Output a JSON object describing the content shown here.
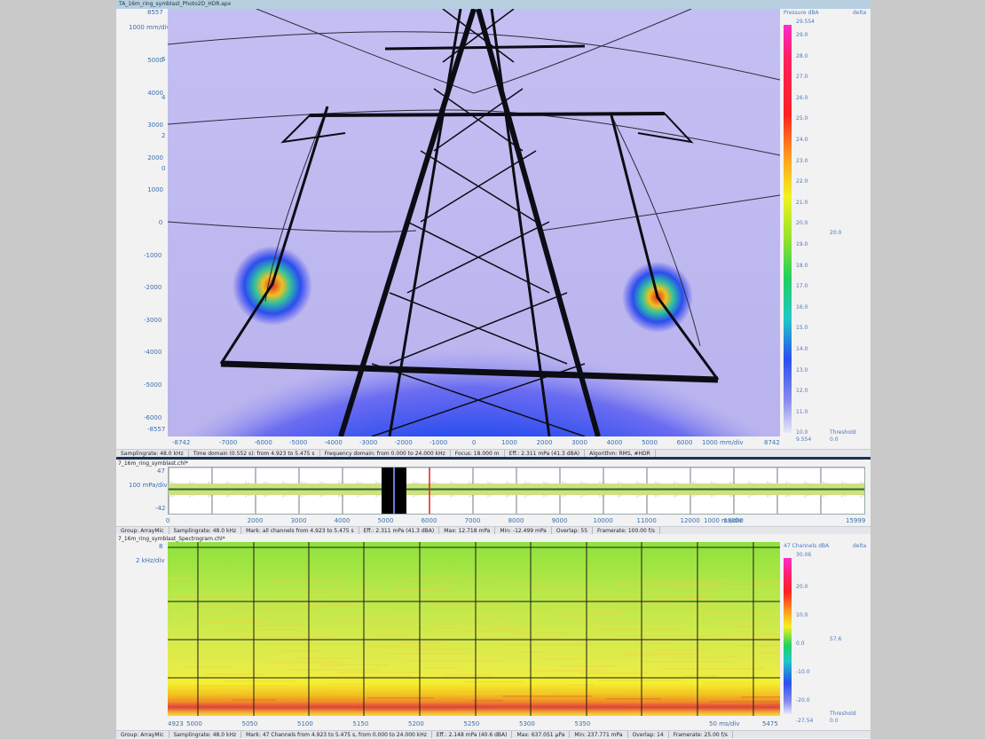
{
  "window": {
    "title": "TA_16m_ring_symblast_Photo2D_HDR.apx"
  },
  "photo": {
    "y_axis": {
      "top": "8557",
      "scale": "1000 mm/div",
      "ticks": [
        "5000",
        "4000",
        "3000",
        "2000",
        "1000",
        "0",
        "-1000",
        "-2000",
        "-3000",
        "-4000",
        "-5000",
        "-6000"
      ],
      "bottom": "-8557"
    },
    "x_axis": {
      "left": "-8742",
      "ticks": [
        "-7000",
        "-6000",
        "-5000",
        "-4000",
        "-3000",
        "-2000",
        "-1000",
        "0",
        "1000",
        "2000",
        "3000",
        "4000",
        "5000",
        "6000"
      ],
      "scale": "1000 mm/div",
      "right": "8742"
    },
    "colorbar": {
      "title": "Pressure dBA",
      "delta": "delta",
      "max": "29.554",
      "ticks": [
        "29.0",
        "28.0",
        "27.0",
        "26.0",
        "25.0",
        "24.0",
        "23.0",
        "22.0",
        "21.0",
        "20.0",
        "19.0",
        "18.0",
        "17.0",
        "16.0",
        "15.0",
        "14.0",
        "13.0",
        "12.0",
        "11.0",
        "10.0"
      ],
      "min": "9.554",
      "side_value": "20.0",
      "threshold_label": "Threshold",
      "threshold_value": "0.0"
    }
  },
  "status1": [
    "Samplingrate: 48.0 kHz",
    "Time domain (0.552 s): from 4.923 to 5.475 s",
    "Frequency domain: from 0.000 to 24.000 kHz",
    "Focus: 18.000 m",
    "Eff.: 2.311 mPa (41.3 dBA)",
    "Algorithm: RMS, #HDR"
  ],
  "time": {
    "title": "7_16m_ring_symblast.chl*",
    "y_top": "47",
    "y_scale": "100 mPa/div",
    "y_bottom": "-42",
    "x_ticks": [
      "0",
      "2000",
      "3000",
      "4000",
      "5000",
      "6000",
      "7000",
      "8000",
      "9000",
      "10000",
      "11000",
      "12000",
      "13000"
    ],
    "x_scale": "1000 ms/div",
    "x_end": "15999"
  },
  "status2": [
    "Group: ArrayMic",
    "Samplingrate: 48.0 kHz",
    "Mark: all channels from 4.923 to 5.475 s",
    "Eff.: 2.311 mPa (41.3 dBA)",
    "Max: 12.718 mPa",
    "Min: -12.499 mPa",
    "Overlap: 55",
    "Framerate: 100.00 f/s"
  ],
  "spectro": {
    "title": "7_16m_ring_symblast_Spectrogram.chl*",
    "y_top": "8",
    "y_scale": "2 kHz/div",
    "y_ticks": [
      "6",
      "4",
      "2",
      "0"
    ],
    "x_start": "4923",
    "x_ticks": [
      "5000",
      "5050",
      "5100",
      "5150",
      "5200",
      "5250",
      "5300",
      "5350"
    ],
    "x_scale": "50 ms/div",
    "x_end": "5475",
    "colorbar": {
      "title": "47 Channels dBA",
      "delta": "delta",
      "max": "30.06",
      "ticks": [
        "20.0",
        "10.0",
        "0.0",
        "-10.0",
        "-20.0"
      ],
      "min": "-27.54",
      "side_value": "57.6",
      "threshold_label": "Threshold",
      "threshold_value": "0.0"
    }
  },
  "status3": [
    "Group: ArrayMic",
    "Samplingrate: 48.0 kHz",
    "Mark: 47 Channels from 4.923 to 5.475 s, from 0.000 to 24.000 kHz",
    "Eff.: 2.148 mPa (40.6 dBA)",
    "Max: 637.051 µPa",
    "Min: 237.771 mPa",
    "Overlap: 14",
    "Framerate: 25.00 f/s"
  ]
}
